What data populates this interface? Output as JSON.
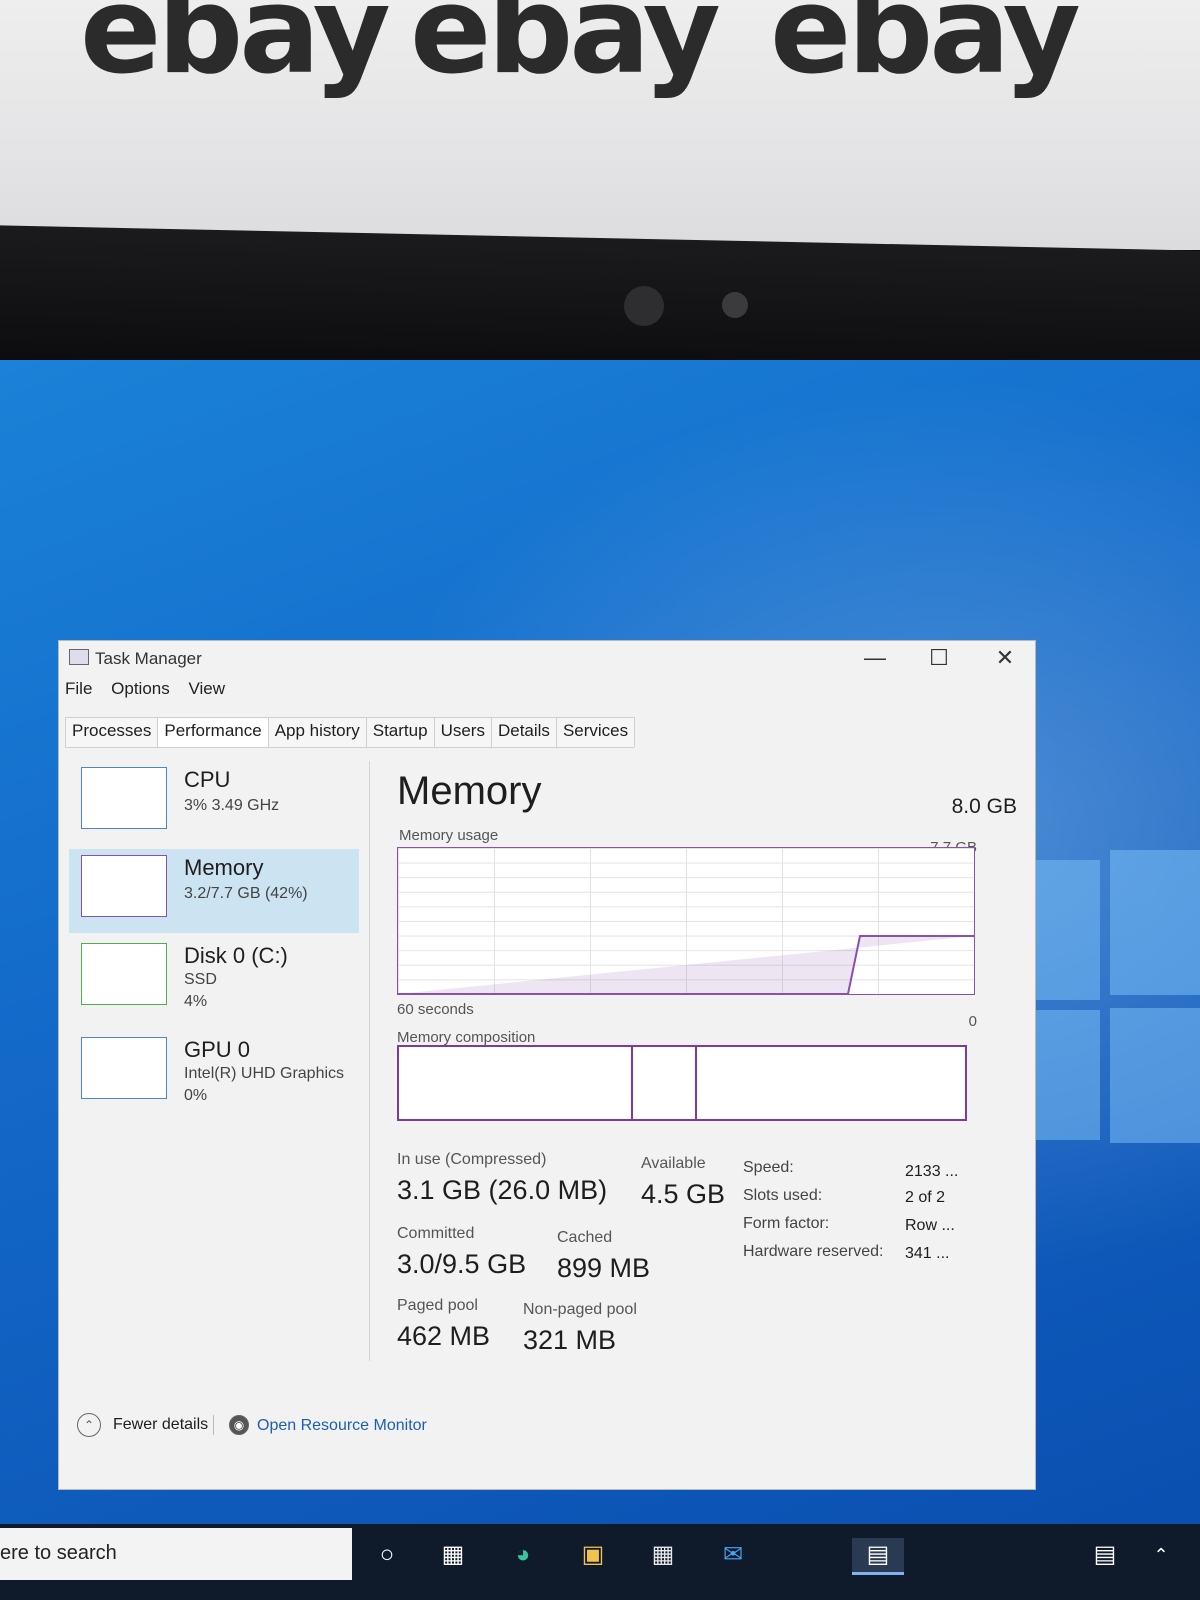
{
  "background": {
    "watermark": [
      "ebay",
      "ebay",
      "ebay"
    ],
    "desktop_color": "#1368c8"
  },
  "window": {
    "title": "Task Manager",
    "minimize_icon": "minimize-icon",
    "maximize_icon": "maximize-icon",
    "close_icon": "close-icon"
  },
  "menu": [
    "File",
    "Options",
    "View"
  ],
  "tabs": [
    {
      "label": "Processes"
    },
    {
      "label": "Performance",
      "active": true
    },
    {
      "label": "App history"
    },
    {
      "label": "Startup"
    },
    {
      "label": "Users"
    },
    {
      "label": "Details"
    },
    {
      "label": "Services"
    }
  ],
  "sidebar": [
    {
      "name": "CPU",
      "sub1": "3%  3.49 GHz",
      "sub2": ""
    },
    {
      "name": "Memory",
      "sub1": "3.2/7.7 GB (42%)",
      "sub2": "",
      "selected": true
    },
    {
      "name": "Disk 0 (C:)",
      "sub1": "SSD",
      "sub2": "4%"
    },
    {
      "name": "GPU 0",
      "sub1": "Intel(R) UHD Graphics",
      "sub2": "0%"
    }
  ],
  "memory": {
    "title": "Memory",
    "capacity": "8.0 GB",
    "usage_label": "Memory usage",
    "usage_max": "7.7 GB",
    "time_label": "60 seconds",
    "usage_min": "0",
    "composition_label": "Memory composition",
    "in_use_label": "In use (Compressed)",
    "in_use_value": "3.1 GB (26.0 MB)",
    "available_label": "Available",
    "available_value": "4.5 GB",
    "committed_label": "Committed",
    "committed_value": "3.0/9.5 GB",
    "cached_label": "Cached",
    "cached_value": "899 MB",
    "paged_label": "Paged pool",
    "paged_value": "462 MB",
    "nonpaged_label": "Non-paged pool",
    "nonpaged_value": "321 MB",
    "specs": [
      {
        "key": "Speed:",
        "value": "2133 ..."
      },
      {
        "key": "Slots used:",
        "value": "2 of 2"
      },
      {
        "key": "Form factor:",
        "value": "Row ..."
      },
      {
        "key": "Hardware reserved:",
        "value": "341 ..."
      }
    ],
    "accent": "#7b3aa6"
  },
  "footer": {
    "fewer_details": "Fewer details",
    "resource_monitor": "Open Resource Monitor"
  },
  "taskbar": {
    "search_text": "ere to search",
    "icons": [
      "cortana-icon",
      "task-view-icon",
      "edge-icon",
      "file-explorer-icon",
      "store-icon",
      "mail-icon",
      "task-manager-icon",
      "news-icon",
      "chevron-up-icon"
    ]
  }
}
